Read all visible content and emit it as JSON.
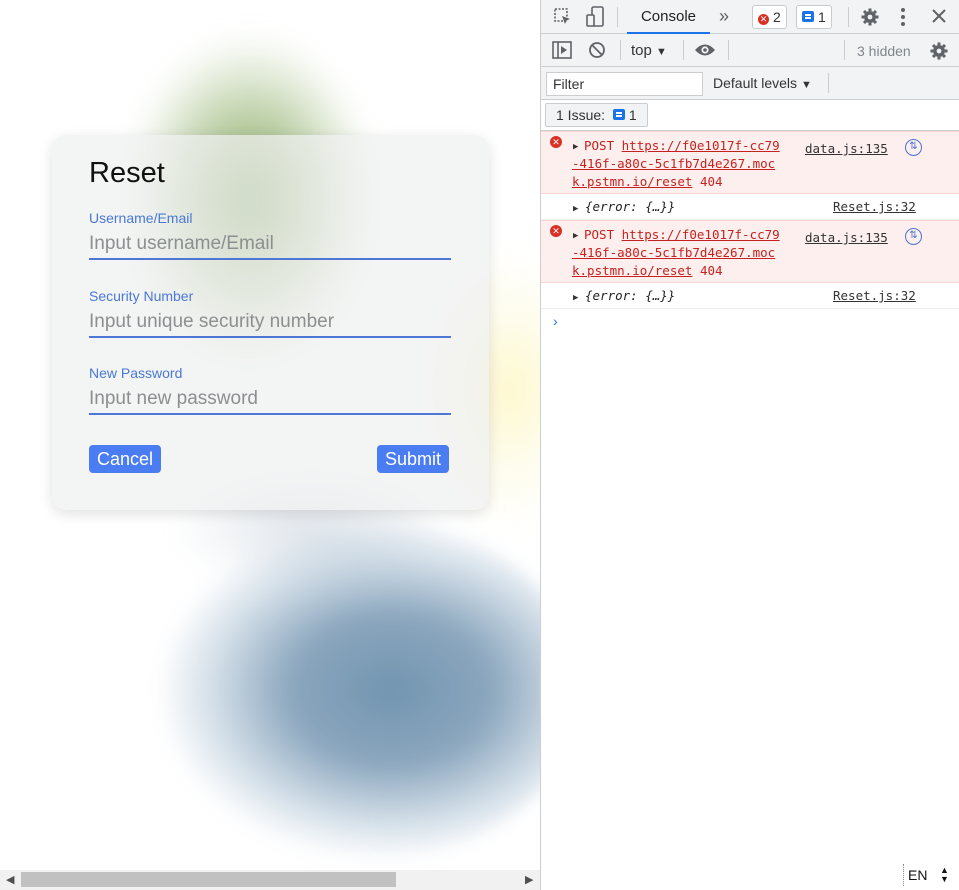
{
  "form": {
    "title": "Reset",
    "fields": [
      {
        "label": "Username/Email",
        "placeholder": "Input username/Email"
      },
      {
        "label": "Security Number",
        "placeholder": "Input unique security number"
      },
      {
        "label": "New Password",
        "placeholder": "Input new password"
      }
    ],
    "cancel_label": "Cancel",
    "submit_label": "Submit"
  },
  "devtools": {
    "tab_console": "Console",
    "more_tabs": "»",
    "error_count": "2",
    "message_count": "1",
    "context": "top",
    "hidden_count": "3 hidden",
    "filter_placeholder": "Filter",
    "levels": "Default levels",
    "issues_label": "1 Issue:",
    "issues_count": "1",
    "logs": [
      {
        "type": "error",
        "method": "POST",
        "url_lines": [
          "https://f0e1017f-cc79",
          "-416f-a80c-5c1fb7d4e267.moc",
          "k.pstmn.io/reset"
        ],
        "status": "404",
        "source": "data.js:135"
      },
      {
        "type": "object",
        "text": "{error: {…}}",
        "source": "Reset.js:32"
      },
      {
        "type": "error",
        "method": "POST",
        "url_lines": [
          "https://f0e1017f-cc79",
          "-416f-a80c-5c1fb7d4e267.moc",
          "k.pstmn.io/reset"
        ],
        "status": "404",
        "source": "data.js:135"
      },
      {
        "type": "object",
        "text": "{error: {…}}",
        "source": "Reset.js:32"
      }
    ],
    "prompt": "›"
  },
  "status": {
    "language": "EN"
  },
  "icons": {
    "inspect": "inspect-icon",
    "device": "device-toggle-icon",
    "settings": "gear-icon",
    "kebab": "kebab-menu-icon",
    "close": "close-icon",
    "sidebar": "sidebar-toggle-icon",
    "clear": "clear-console-icon",
    "eye": "live-expression-icon"
  },
  "colors": {
    "accent": "#4a7cf2",
    "field_label": "#4a78d6",
    "error_red": "#d93025",
    "error_bg": "#fcefee",
    "devtools_blue": "#1a73e8"
  }
}
